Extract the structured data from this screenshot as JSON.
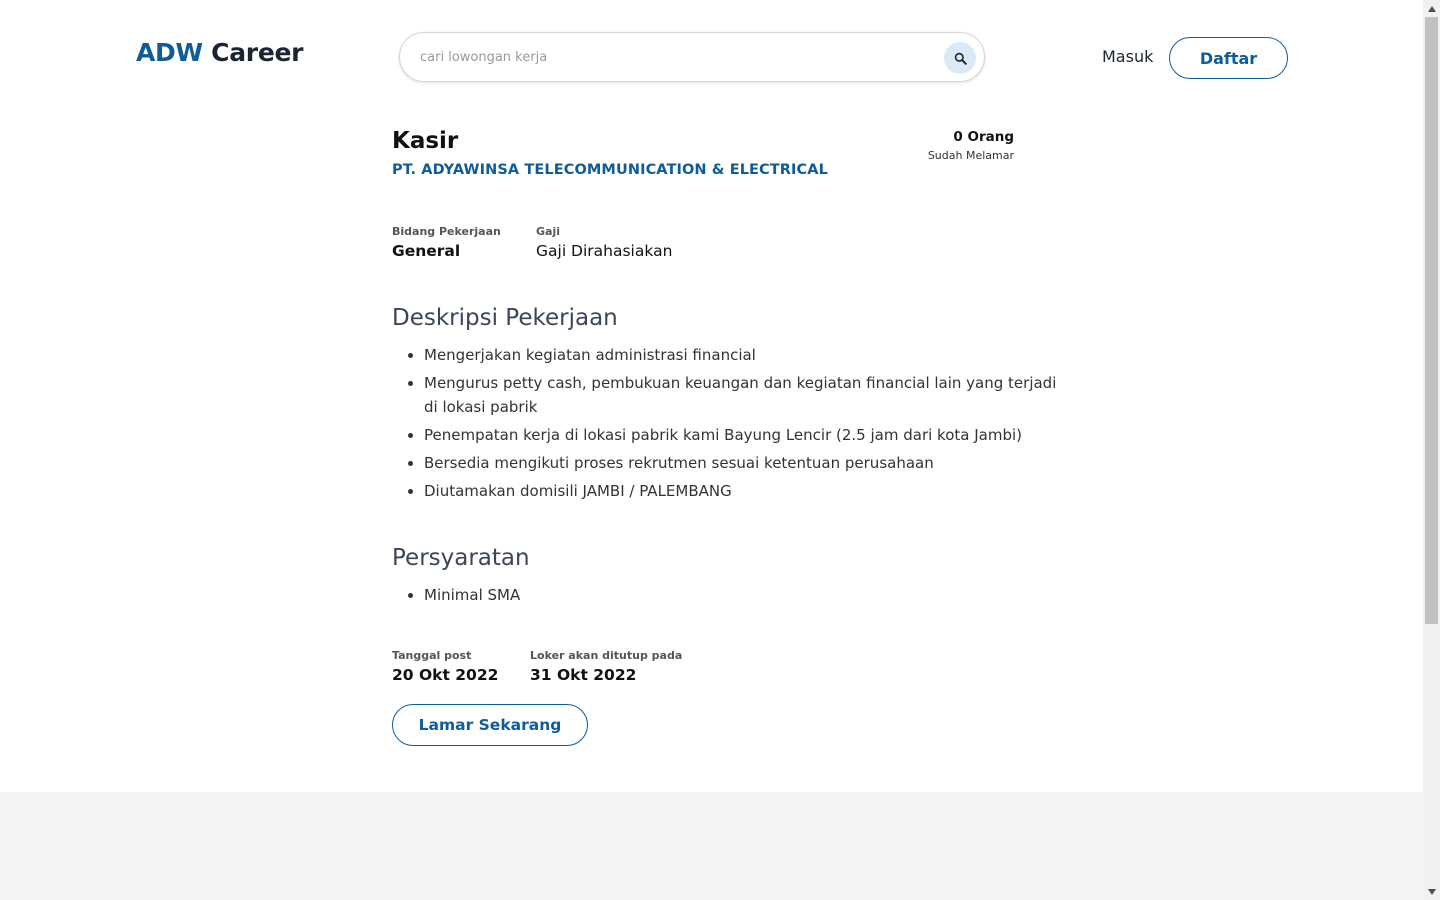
{
  "header": {
    "logo_brand": "ADW",
    "logo_suffix": " Career",
    "search_placeholder": "cari lowongan kerja",
    "search_icon": "magnifier-icon",
    "login_label": "Masuk",
    "register_label": "Daftar"
  },
  "job": {
    "title": "Kasir",
    "company": "PT. ADYAWINSA TELECOMMUNICATION & ELECTRICAL",
    "applicants_count": "0 Orang",
    "applicants_label": "Sudah Melamar",
    "field_label": "Bidang Pekerjaan",
    "field_value": "General",
    "salary_label": "Gaji",
    "salary_value": "Gaji Dirahasiakan"
  },
  "description": {
    "title": "Deskripsi Pekerjaan",
    "items": [
      "Mengerjakan kegiatan administrasi financial",
      "Mengurus petty cash, pembukuan keuangan dan kegiatan financial lain yang terjadi di lokasi pabrik",
      "Penempatan kerja di lokasi pabrik kami Bayung Lencir (2.5 jam dari kota Jambi)",
      "Bersedia mengikuti proses rekrutmen sesuai ketentuan perusahaan",
      "Diutamakan domisili JAMBI / PALEMBANG"
    ]
  },
  "requirements": {
    "title": "Persyaratan",
    "items": [
      "Minimal SMA"
    ]
  },
  "dates": {
    "posted_label": "Tanggal post",
    "posted_value": "20 Okt 2022",
    "closing_label": "Loker akan ditutup pada",
    "closing_value": "31 Okt 2022"
  },
  "actions": {
    "apply_label": "Lamar Sekarang"
  },
  "colors": {
    "brand_blue": "#0f5c9a",
    "footer_bg": "#f4f4f4"
  }
}
